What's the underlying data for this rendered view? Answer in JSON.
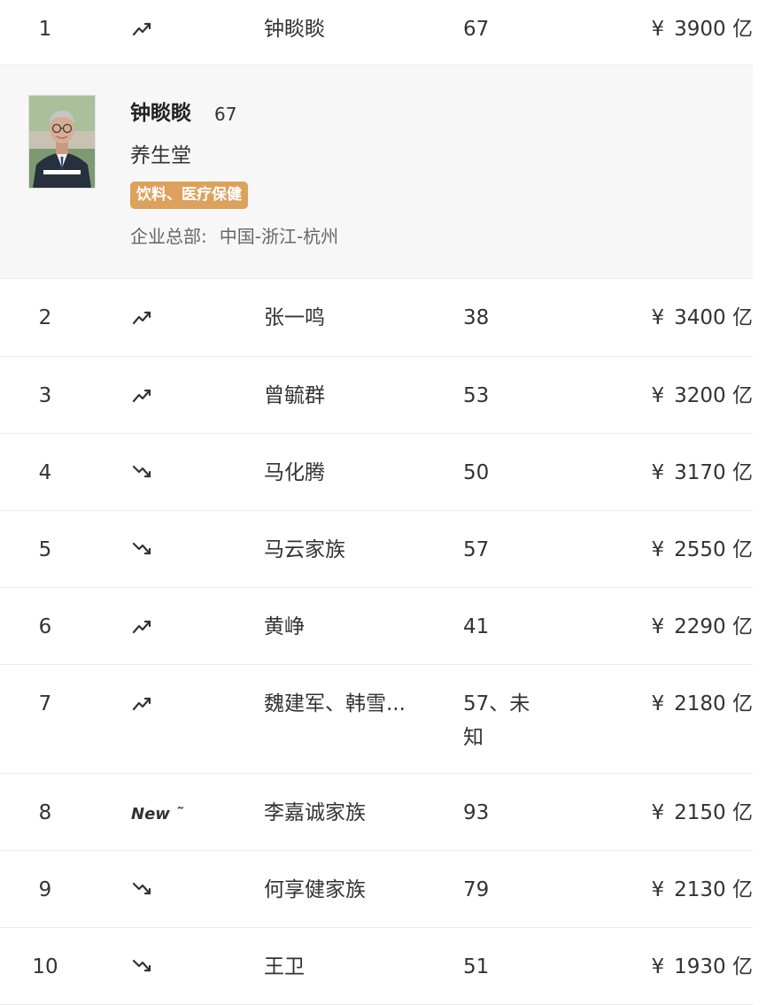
{
  "currency_symbol": "¥",
  "rows": [
    {
      "rank": "1",
      "trend": "up",
      "trend_icon": "trend-up-icon",
      "name": "钟睒睒",
      "age": "67",
      "worth": "3900 亿"
    },
    {
      "rank": "2",
      "trend": "up",
      "trend_icon": "trend-up-icon",
      "name": "张一鸣",
      "age": "38",
      "worth": "3400 亿"
    },
    {
      "rank": "3",
      "trend": "up",
      "trend_icon": "trend-up-icon",
      "name": "曾毓群",
      "age": "53",
      "worth": "3200 亿"
    },
    {
      "rank": "4",
      "trend": "down",
      "trend_icon": "trend-down-icon",
      "name": "马化腾",
      "age": "50",
      "worth": "3170 亿"
    },
    {
      "rank": "5",
      "trend": "down",
      "trend_icon": "trend-down-icon",
      "name": "马云家族",
      "age": "57",
      "worth": "2550 亿"
    },
    {
      "rank": "6",
      "trend": "up",
      "trend_icon": "trend-up-icon",
      "name": "黄峥",
      "age": "41",
      "worth": "2290 亿"
    },
    {
      "rank": "7",
      "trend": "up",
      "trend_icon": "trend-up-icon",
      "name": "魏建军、韩雪...",
      "age": "57、未知",
      "worth": "2180 亿"
    },
    {
      "rank": "8",
      "trend": "new",
      "trend_label": "New",
      "trend_icon": "new-badge-icon",
      "name": "李嘉诚家族",
      "age": "93",
      "worth": "2150 亿"
    },
    {
      "rank": "9",
      "trend": "down",
      "trend_icon": "trend-down-icon",
      "name": "何享健家族",
      "age": "79",
      "worth": "2130 亿"
    },
    {
      "rank": "10",
      "trend": "down",
      "trend_icon": "trend-down-icon",
      "name": "王卫",
      "age": "51",
      "worth": "1930 亿"
    }
  ],
  "detail": {
    "after_rank": "1",
    "avatar_icon": "portrait-photo",
    "name": "钟睒睒",
    "age": "67",
    "company": "养生堂",
    "tag": "饮料、医疗保健",
    "hq_label": "企业总部:",
    "hq_value": "中国-浙江-杭州"
  },
  "colors": {
    "tag_bg": "#dda15e",
    "detail_bg": "#f7f7f7",
    "divider": "#ececec",
    "text": "#333333"
  }
}
